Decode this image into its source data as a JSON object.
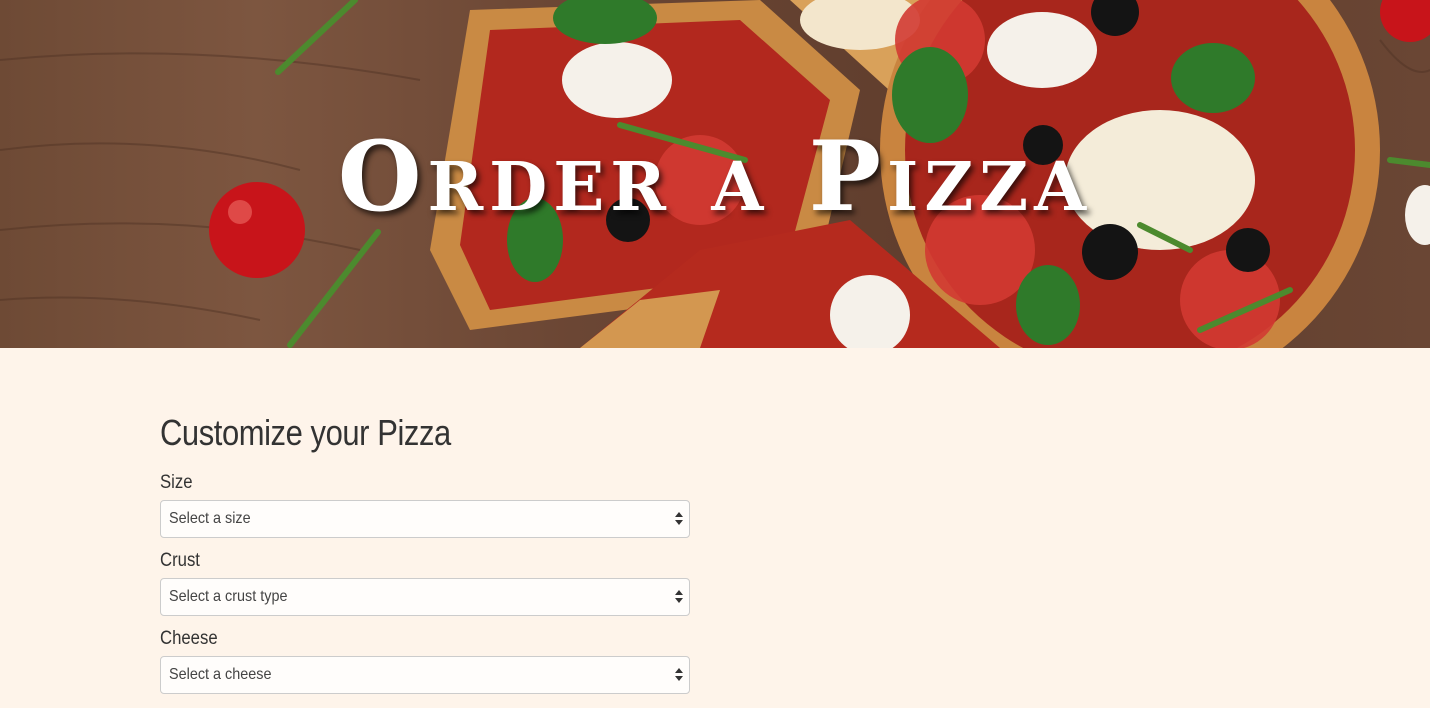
{
  "hero": {
    "title": "Order a Pizza",
    "image": "pizza-on-wooden-table-photo"
  },
  "form": {
    "heading": "Customize your Pizza",
    "fields": [
      {
        "label": "Size",
        "value": "Select a size"
      },
      {
        "label": "Crust",
        "value": "Select a crust type"
      },
      {
        "label": "Cheese",
        "value": "Select a cheese"
      }
    ]
  },
  "colors": {
    "page_background": "#fef4ea",
    "text": "#333333",
    "select_border": "#cccccc"
  }
}
